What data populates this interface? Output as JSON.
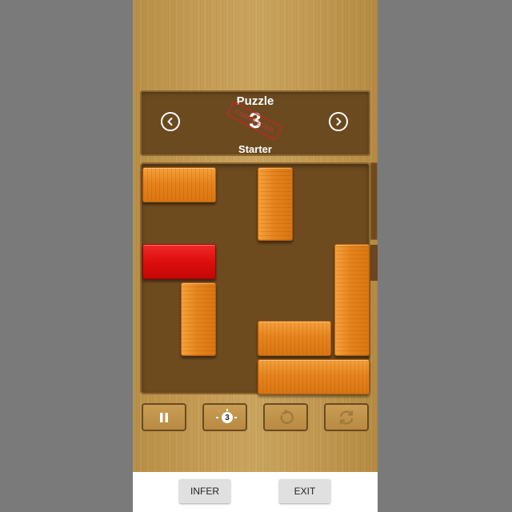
{
  "header": {
    "puzzle_label": "Puzzle",
    "puzzle_number": "3",
    "difficulty": "Starter",
    "stamp_text": "COMPLETED"
  },
  "controls": {
    "hints_remaining": "3"
  },
  "board": {
    "grid_size": 6,
    "blocks": [
      {
        "id": "h1",
        "orientation": "horizontal",
        "color": "orange",
        "row": 0,
        "col": 0,
        "length": 2
      },
      {
        "id": "v1",
        "orientation": "vertical",
        "color": "orange",
        "row": 0,
        "col": 3,
        "length": 2
      },
      {
        "id": "target",
        "orientation": "horizontal",
        "color": "red",
        "row": 2,
        "col": 0,
        "length": 2
      },
      {
        "id": "v2",
        "orientation": "vertical",
        "color": "orange",
        "row": 3,
        "col": 1,
        "length": 2
      },
      {
        "id": "v3",
        "orientation": "vertical",
        "color": "orange",
        "row": 2,
        "col": 5,
        "length": 3
      },
      {
        "id": "h2",
        "orientation": "horizontal",
        "color": "orange",
        "row": 4,
        "col": 3,
        "length": 2
      },
      {
        "id": "h3",
        "orientation": "horizontal",
        "color": "orange",
        "row": 5,
        "col": 3,
        "length": 3
      }
    ]
  },
  "bottom_bar": {
    "infer_label": "INFER",
    "exit_label": "EXIT"
  },
  "colors": {
    "board": "#6e4b1f",
    "block_orange": "#e6841d",
    "block_red": "#dd0e0e"
  }
}
